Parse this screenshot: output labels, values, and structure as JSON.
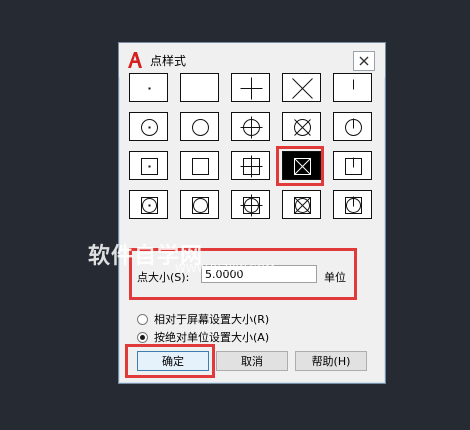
{
  "dialog": {
    "title": "点样式",
    "close_icon": "close-icon"
  },
  "point_styles": [
    [
      "dot",
      "empty",
      "plus",
      "x",
      "tick"
    ],
    [
      "circle-dot",
      "circle",
      "circle-plus",
      "circle-x",
      "circle-tick"
    ],
    [
      "square-dot",
      "square",
      "square-plus",
      "square-x",
      "square-tick"
    ],
    [
      "circle-square-dot",
      "circle-square",
      "circle-square-plus",
      "circle-square-x",
      "circle-square-tick"
    ]
  ],
  "selected_style": "square-x",
  "point_size": {
    "label": "点大小(S):",
    "value": "5.0000",
    "unit": "单位"
  },
  "size_mode": {
    "option_relative": "相对于屏幕设置大小(R)",
    "option_absolute": "按绝对单位设置大小(A)",
    "selected": "absolute"
  },
  "buttons": {
    "ok": "确定",
    "cancel": "取消",
    "help": "帮助(H)"
  },
  "watermark": {
    "text": "软件自学网",
    "url": "WWW.RJZXW.COM"
  },
  "colors": {
    "background": "#262a33",
    "highlight": "#e03a3a"
  }
}
